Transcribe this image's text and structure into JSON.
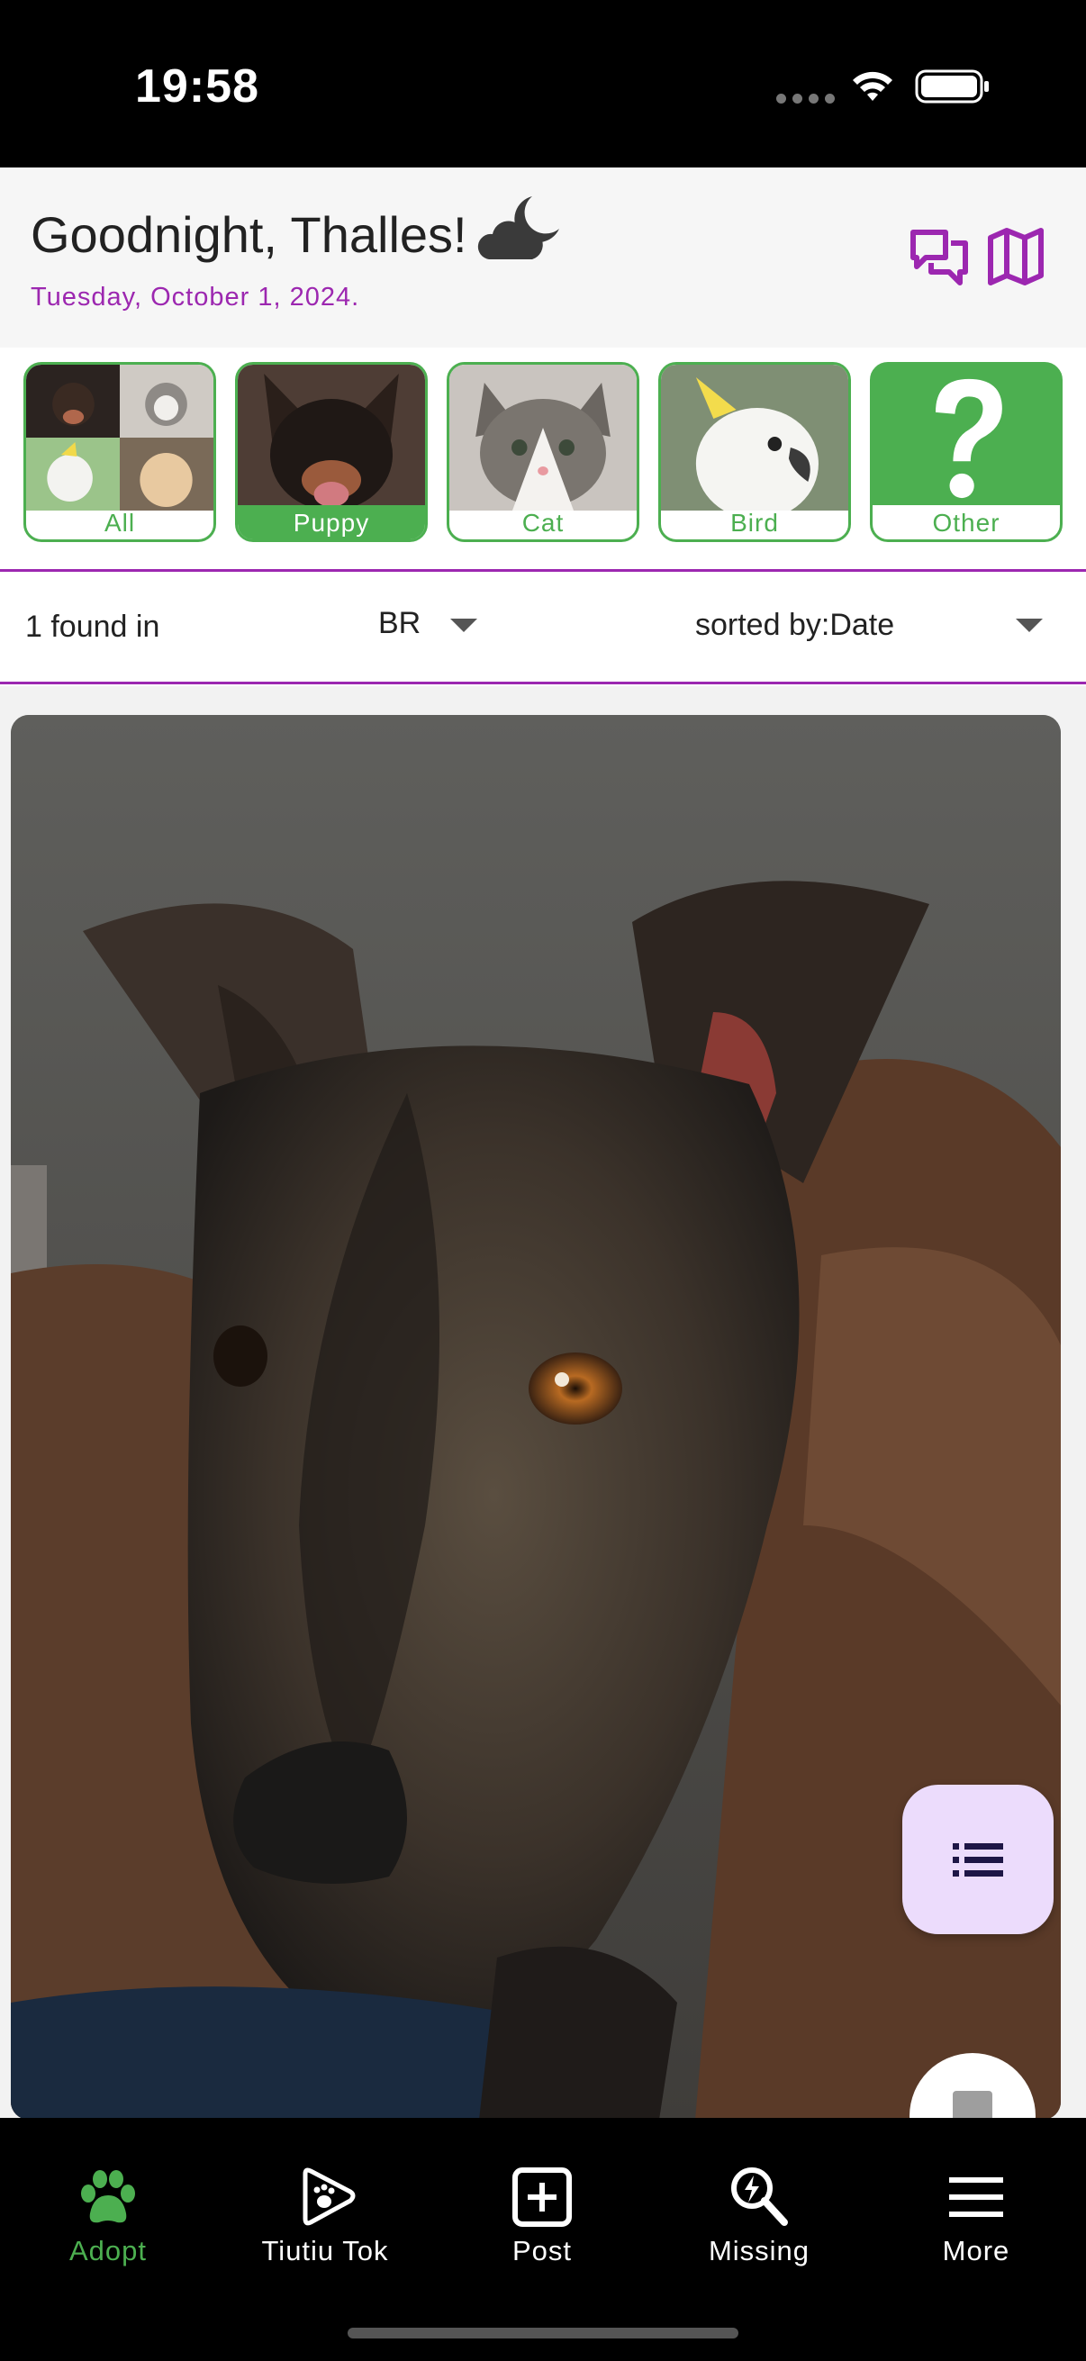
{
  "status_bar": {
    "time": "19:58"
  },
  "header": {
    "greeting": "Goodnight, Thalles!",
    "date": "Tuesday, October 1, 2024.",
    "icons": [
      "moon-cloud-icon",
      "chat-icon",
      "map-icon"
    ]
  },
  "categories": [
    {
      "label": "All",
      "selected": false
    },
    {
      "label": "Puppy",
      "selected": true
    },
    {
      "label": "Cat",
      "selected": false
    },
    {
      "label": "Bird",
      "selected": false
    },
    {
      "label": "Other",
      "selected": false
    }
  ],
  "filter": {
    "found_text": "1 found in",
    "country": "BR",
    "sort_prefix": "sorted by:",
    "sort_value": "Date"
  },
  "fab": {
    "icon": "list-icon"
  },
  "bottom_nav": {
    "items": [
      {
        "label": "Adopt",
        "icon": "paw-icon",
        "active": true
      },
      {
        "label": "Tiutiu Tok",
        "icon": "play-paw-icon",
        "active": false
      },
      {
        "label": "Post",
        "icon": "add-box-icon",
        "active": false
      },
      {
        "label": "Missing",
        "icon": "search-bolt-icon",
        "active": false
      },
      {
        "label": "More",
        "icon": "menu-icon",
        "active": false
      }
    ]
  },
  "colors": {
    "accent_purple": "#9c27b0",
    "accent_green": "#4caf50",
    "fab_bg": "#ecdcfc"
  }
}
